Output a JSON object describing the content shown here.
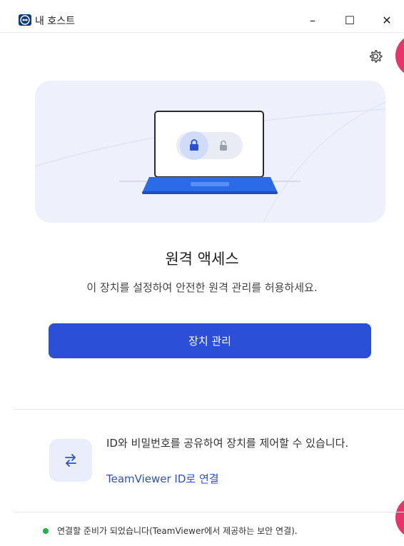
{
  "window": {
    "title": "내 호스트",
    "minimize_glyph": "–",
    "maximize_glyph": "☐",
    "close_glyph": "✕"
  },
  "main": {
    "heading": "원격 액세스",
    "description": "이 장치를 설정하여 안전한 원격 관리를 허용하세요.",
    "manage_button": "장치 관리"
  },
  "id_section": {
    "text": "ID와 비밀번호를 공유하여 장치를 제어할 수 있습니다.",
    "link": "TeamViewer ID로 연결",
    "icon": "swap-arrows-icon"
  },
  "status": {
    "text": "연결할 준비가 되었습니다(TeamViewer에서 제공하는 보안 연결).",
    "color": "#22b14c"
  },
  "colors": {
    "accent": "#2b4fd6",
    "hero_bg": "#eef1fb",
    "brand": "#0e3a78",
    "side_tab": "#e8336b"
  }
}
